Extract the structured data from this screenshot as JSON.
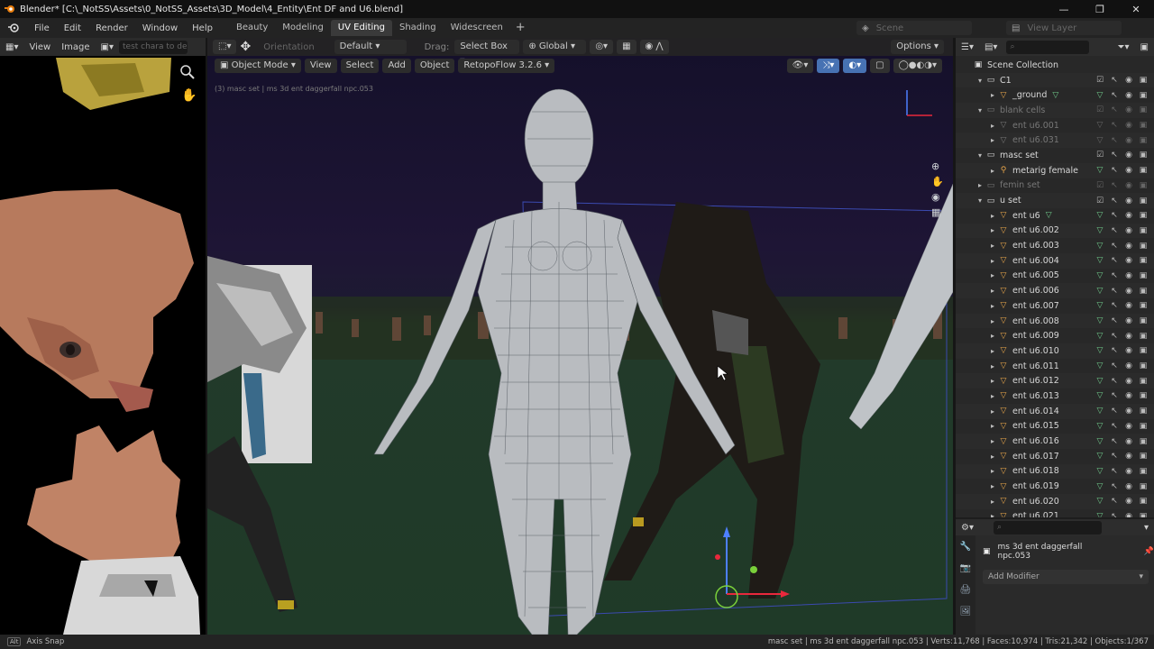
{
  "window": {
    "title": "Blender* [C:\\_NotSS\\Assets\\0_NotSS_Assets\\3D_Model\\4_Entity\\Ent DF and U6.blend]",
    "controls": [
      "—",
      "❐",
      "✕"
    ]
  },
  "menu": {
    "items": [
      "File",
      "Edit",
      "Render",
      "Window",
      "Help"
    ],
    "workspaces": [
      {
        "label": "Beauty",
        "active": false
      },
      {
        "label": "Modeling",
        "active": false
      },
      {
        "label": "UV Editing",
        "active": true
      },
      {
        "label": "Shading",
        "active": false
      },
      {
        "label": "Widescreen",
        "active": false
      }
    ],
    "add_workspace": "+",
    "scene_label": "Scene",
    "view_layer_label": "View Layer"
  },
  "image_editor": {
    "view_label": "View",
    "image_label": "Image",
    "image_name_placeholder": "test chara to delete"
  },
  "viewport": {
    "orientation_label": "Orientation",
    "default_label": "Default",
    "drag_label": "Drag:",
    "select_box_label": "Select Box",
    "global_label": "Global",
    "options_label": "Options",
    "mode_label": "Object Mode",
    "view_label": "View",
    "select_label": "Select",
    "add_label": "Add",
    "object_label": "Object",
    "addon_label": "RetopoFlow 3.2.6",
    "info_text": "(3) masc set | ms 3d ent daggerfall npc.053"
  },
  "outliner": {
    "rows": [
      {
        "label": "Scene Collection",
        "type": "scene",
        "indent": 0,
        "dim": false
      },
      {
        "label": "C1",
        "type": "collection",
        "indent": 1,
        "dim": false,
        "open": true
      },
      {
        "label": "_ground",
        "type": "object",
        "indent": 2,
        "dim": false,
        "extra": "▽"
      },
      {
        "label": "blank cells",
        "type": "collection",
        "indent": 1,
        "dim": true,
        "open": true
      },
      {
        "label": "ent u6.001",
        "type": "object",
        "indent": 2,
        "dim": true
      },
      {
        "label": "ent u6.031",
        "type": "object",
        "indent": 2,
        "dim": true
      },
      {
        "label": "masc set",
        "type": "collection",
        "indent": 1,
        "dim": false,
        "open": true
      },
      {
        "label": "metarig female",
        "type": "armature",
        "indent": 2,
        "dim": false
      },
      {
        "label": "femin set",
        "type": "collection",
        "indent": 1,
        "dim": true
      },
      {
        "label": "u set",
        "type": "collection",
        "indent": 1,
        "dim": false,
        "open": true
      },
      {
        "label": "ent u6",
        "type": "object",
        "indent": 2,
        "dim": false,
        "extra": "▽"
      },
      {
        "label": "ent u6.002",
        "type": "object",
        "indent": 2,
        "dim": false
      },
      {
        "label": "ent u6.003",
        "type": "object",
        "indent": 2,
        "dim": false
      },
      {
        "label": "ent u6.004",
        "type": "object",
        "indent": 2,
        "dim": false
      },
      {
        "label": "ent u6.005",
        "type": "object",
        "indent": 2,
        "dim": false
      },
      {
        "label": "ent u6.006",
        "type": "object",
        "indent": 2,
        "dim": false
      },
      {
        "label": "ent u6.007",
        "type": "object",
        "indent": 2,
        "dim": false
      },
      {
        "label": "ent u6.008",
        "type": "object",
        "indent": 2,
        "dim": false
      },
      {
        "label": "ent u6.009",
        "type": "object",
        "indent": 2,
        "dim": false
      },
      {
        "label": "ent u6.010",
        "type": "object",
        "indent": 2,
        "dim": false
      },
      {
        "label": "ent u6.011",
        "type": "object",
        "indent": 2,
        "dim": false
      },
      {
        "label": "ent u6.012",
        "type": "object",
        "indent": 2,
        "dim": false
      },
      {
        "label": "ent u6.013",
        "type": "object",
        "indent": 2,
        "dim": false
      },
      {
        "label": "ent u6.014",
        "type": "object",
        "indent": 2,
        "dim": false
      },
      {
        "label": "ent u6.015",
        "type": "object",
        "indent": 2,
        "dim": false
      },
      {
        "label": "ent u6.016",
        "type": "object",
        "indent": 2,
        "dim": false
      },
      {
        "label": "ent u6.017",
        "type": "object",
        "indent": 2,
        "dim": false
      },
      {
        "label": "ent u6.018",
        "type": "object",
        "indent": 2,
        "dim": false
      },
      {
        "label": "ent u6.019",
        "type": "object",
        "indent": 2,
        "dim": false
      },
      {
        "label": "ent u6.020",
        "type": "object",
        "indent": 2,
        "dim": false
      },
      {
        "label": "ent u6.021",
        "type": "object",
        "indent": 2,
        "dim": false
      }
    ]
  },
  "properties": {
    "object_name": "ms 3d ent daggerfall npc.053",
    "add_modifier_label": "Add Modifier"
  },
  "statusbar": {
    "left_key": "Alt",
    "left_text": "Axis Snap",
    "right_text": "masc set | ms 3d ent daggerfall npc.053 | Verts:11,768 | Faces:10,974 | Tris:21,342 | Objects:1/367"
  },
  "colors": {
    "accent_blue": "#4772b3",
    "active_tab": "#3a3a3a",
    "mesh_icon": "#e8a54a",
    "green_data": "#6fc98a"
  }
}
